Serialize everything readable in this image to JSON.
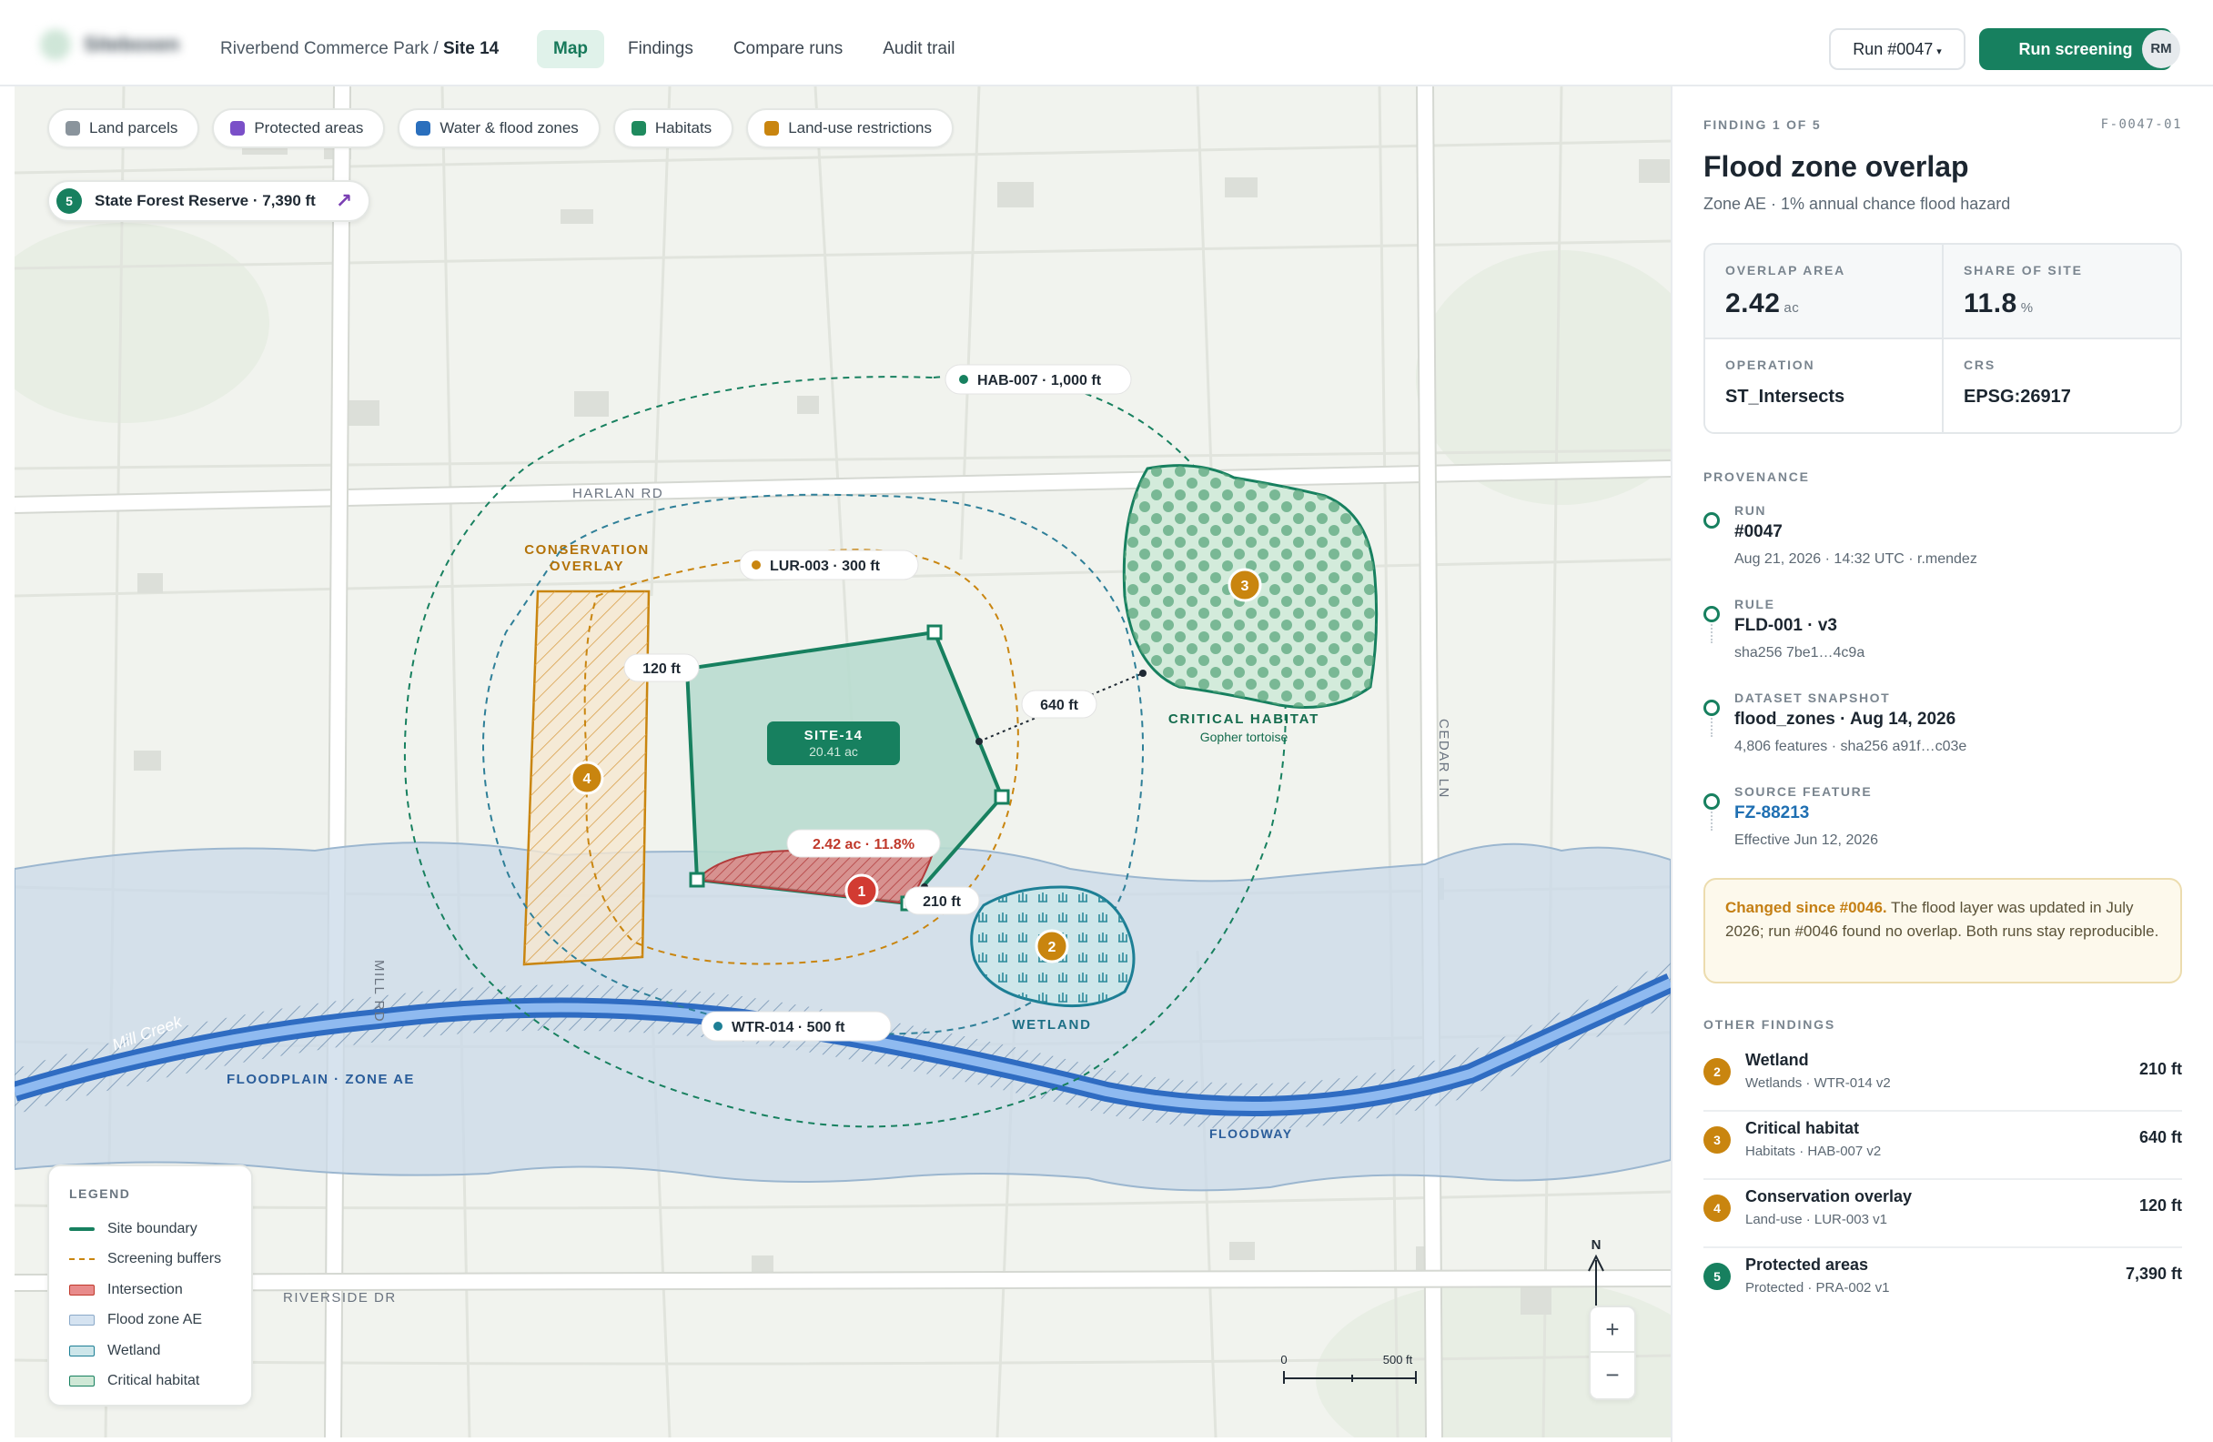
{
  "app": {
    "logo_text": "Siteboxen"
  },
  "breadcrumb": {
    "project": "Riverbend Commerce Park",
    "separator": " / ",
    "site": "Site 14"
  },
  "tabs": [
    {
      "label": "Map",
      "active": true
    },
    {
      "label": "Findings",
      "active": false
    },
    {
      "label": "Compare runs",
      "active": false
    },
    {
      "label": "Audit trail",
      "active": false
    }
  ],
  "header": {
    "run_select": "Run #0047",
    "run_button": "Run screening",
    "avatar_initials": "RM"
  },
  "layers": [
    {
      "label": "Land parcels",
      "color": "#8a949c"
    },
    {
      "label": "Protected areas",
      "color": "#7a4fc8"
    },
    {
      "label": "Water & flood zones",
      "color": "#2a6fbd"
    },
    {
      "label": "Habitats",
      "color": "#1f8a5e"
    },
    {
      "label": "Land-use restrictions",
      "color": "#c9850f"
    }
  ],
  "offmap": {
    "number": "5",
    "label": "State Forest Reserve · 7,390 ft",
    "icon": "arrow-up-right-icon"
  },
  "map_labels": {
    "harlan_rd": "HARLAN RD",
    "cedar_ln": "CEDAR LN",
    "mill_rd": "MILL RD",
    "riverside_dr": "RIVERSIDE DR",
    "mill_creek": "Mill Creek",
    "floodplain": "FLOODPLAIN · ZONE AE",
    "floodway": "FLOODWAY",
    "conservation_1": "CONSERVATION",
    "conservation_2": "OVERLAY",
    "critical_habitat": "CRITICAL HABITAT",
    "gopher": "Gopher tortoise",
    "wetland": "WETLAND",
    "site_name": "SITE-14",
    "site_area": "20.41 ac",
    "intersection": "2.42 ac · 11.8%",
    "dist_120": "120 ft",
    "dist_640": "640 ft",
    "dist_210": "210 ft",
    "hab_buffer": "HAB-007 · 1,000 ft",
    "lur_buffer": "LUR-003 · 300 ft",
    "wtr_buffer": "WTR-014 · 500 ft",
    "marker_1": "1",
    "marker_2": "2",
    "marker_3": "3",
    "marker_4": "4",
    "north": "N",
    "scale_0": "0",
    "scale_500": "500 ft"
  },
  "legend": {
    "title": "LEGEND",
    "items": [
      {
        "label": "Site boundary",
        "color": "#17805f"
      },
      {
        "label": "Screening buffers",
        "color": "#c9850f"
      },
      {
        "label": "Intersection",
        "color": "#e07a7a"
      },
      {
        "label": "Flood zone AE",
        "color": "#cfdfee"
      },
      {
        "label": "Wetland",
        "color": "#cde6ea"
      },
      {
        "label": "Critical habitat",
        "color": "#cfe8d6"
      }
    ]
  },
  "zoom": {
    "in": "+",
    "out": "−"
  },
  "finding": {
    "count": "FINDING 1 OF 5",
    "id": "F-0047-01",
    "title": "Flood zone overlap",
    "subtitle": "Zone AE · 1% annual chance flood hazard",
    "stats": {
      "overlap_label": "OVERLAP AREA",
      "overlap_value": "2.42",
      "overlap_unit": "ac",
      "share_label": "SHARE OF SITE",
      "share_value": "11.8",
      "share_unit": "%",
      "operation_label": "OPERATION",
      "operation_value": "ST_Intersects",
      "crs_label": "CRS",
      "crs_value": "EPSG:26917"
    }
  },
  "provenance": {
    "title": "PROVENANCE",
    "items": [
      {
        "label": "RUN",
        "value": "#0047",
        "meta": "Aug 21, 2026 · 14:32 UTC · r.mendez"
      },
      {
        "label": "RULE",
        "value": "FLD-001 · v3",
        "meta": "sha256 7be1…4c9a"
      },
      {
        "label": "DATASET SNAPSHOT",
        "value": "flood_zones · Aug 14, 2026",
        "meta": "4,806 features · sha256 a91f…c03e"
      },
      {
        "label": "SOURCE FEATURE",
        "value": "FZ-88213",
        "meta": "Effective Jun 12, 2026"
      }
    ]
  },
  "changed": {
    "bold": "Changed since #0046.",
    "text": " The flood layer was updated in July 2026; run #0046 found no overlap. Both runs stay reproducible."
  },
  "other_findings": {
    "title": "OTHER FINDINGS",
    "items": [
      {
        "num": "2",
        "name": "Wetland",
        "sub": "Wetlands · WTR-014 v2",
        "distance": "210 ft",
        "color": "#c9850f"
      },
      {
        "num": "3",
        "name": "Critical habitat",
        "sub": "Habitats · HAB-007 v2",
        "distance": "640 ft",
        "color": "#c9850f"
      },
      {
        "num": "4",
        "name": "Conservation overlay",
        "sub": "Land-use · LUR-003 v1",
        "distance": "120 ft",
        "color": "#c9850f"
      },
      {
        "num": "5",
        "name": "Protected areas",
        "sub": "Protected · PRA-002 v1",
        "distance": "7,390 ft",
        "color": "#17805f"
      }
    ]
  }
}
